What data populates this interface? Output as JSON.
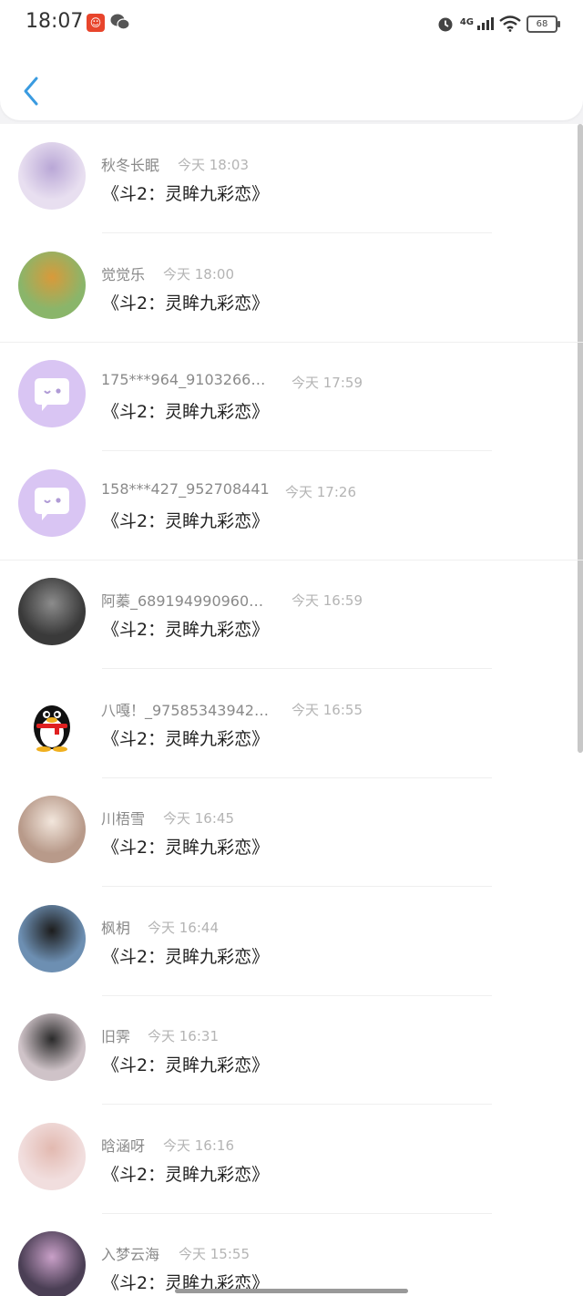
{
  "status_bar": {
    "time": "18:07",
    "network": "4G",
    "battery": "68"
  },
  "header": {
    "back_icon": "chevron-left-icon"
  },
  "items": [
    {
      "name": "秋冬长眠",
      "time": "今天 18:03",
      "message": "《斗2：灵眸九彩恋》",
      "avatar_color": "#e8dff0",
      "avatar_accent": "#b9a7d6"
    },
    {
      "name": "觉觉乐",
      "time": "今天 18:00",
      "message": "《斗2：灵眸九彩恋》",
      "avatar_color": "#8ab56a",
      "avatar_accent": "#d99a3a"
    },
    {
      "name": "175***964_9103266…",
      "time": "今天 17:59",
      "message": "《斗2：灵眸九彩恋》",
      "avatar_color": "#d9c5f3",
      "avatar_accent": "#ffffff"
    },
    {
      "name": "158***427_952708441",
      "time": "今天 17:26",
      "message": "《斗2：灵眸九彩恋》",
      "avatar_color": "#d9c5f3",
      "avatar_accent": "#ffffff"
    },
    {
      "name": "阿蓁_689194990960…",
      "time": "今天 16:59",
      "message": "《斗2：灵眸九彩恋》",
      "avatar_color": "#3a3a3a",
      "avatar_accent": "#8c8c8c"
    },
    {
      "name": "八嘎！_97585343942…",
      "time": "今天 16:55",
      "message": "《斗2：灵眸九彩恋》",
      "avatar_color": "#ffffff",
      "avatar_accent": "#111111"
    },
    {
      "name": "川梧雪",
      "time": "今天 16:45",
      "message": "《斗2：灵眸九彩恋》",
      "avatar_color": "#b89a8a",
      "avatar_accent": "#f2e6dc"
    },
    {
      "name": "枫枂",
      "time": "今天 16:44",
      "message": "《斗2：灵眸九彩恋》",
      "avatar_color": "#6d8fb2",
      "avatar_accent": "#1d1d1d"
    },
    {
      "name": "旧霁",
      "time": "今天 16:31",
      "message": "《斗2：灵眸九彩恋》",
      "avatar_color": "#cfc3c8",
      "avatar_accent": "#2a2a2a"
    },
    {
      "name": "晗涵呀",
      "time": "今天 16:16",
      "message": "《斗2：灵眸九彩恋》",
      "avatar_color": "#f1dede",
      "avatar_accent": "#e2b9b0"
    },
    {
      "name": "入梦云海",
      "time": "今天 15:55",
      "message": "《斗2：灵眸九彩恋》",
      "avatar_color": "#4b3f55",
      "avatar_accent": "#c9a0c8"
    }
  ]
}
